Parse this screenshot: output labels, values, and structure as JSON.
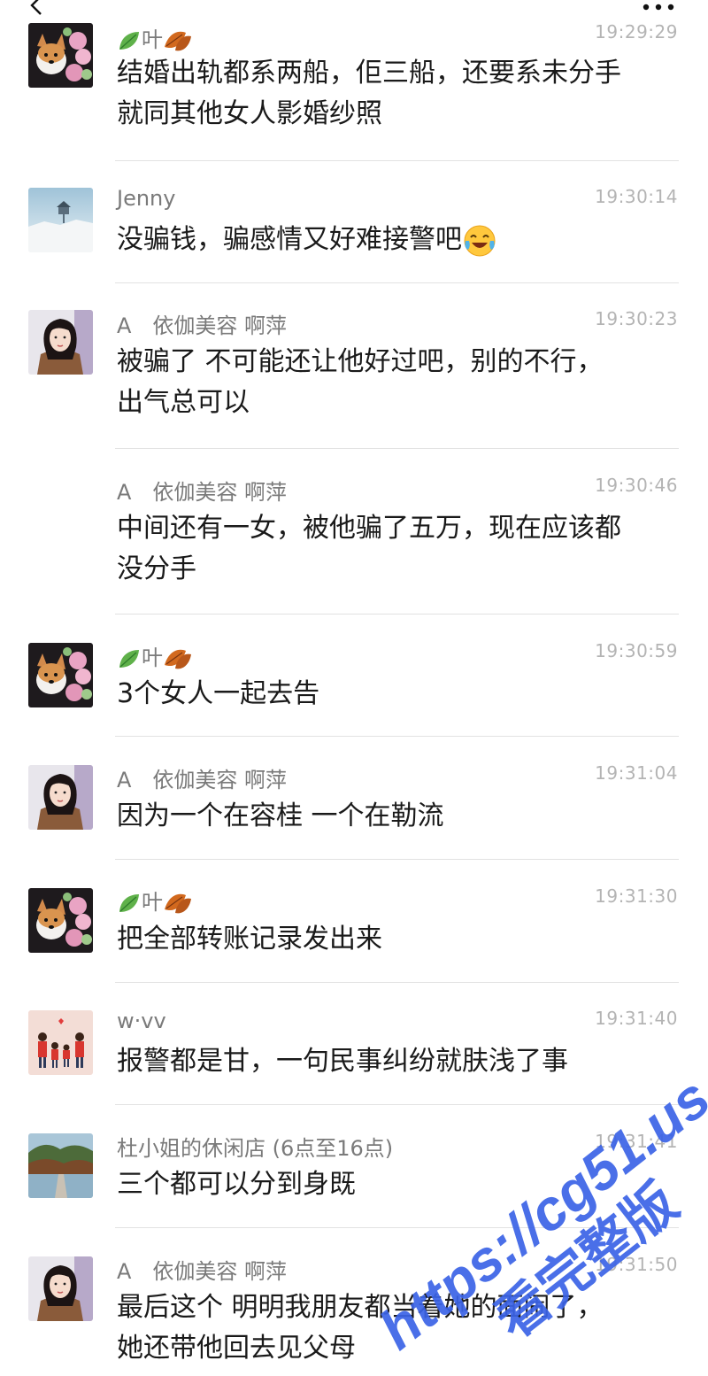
{
  "nav": {
    "back_icon": "chevron-left-icon",
    "more_icon": "more-dots-icon"
  },
  "messages": [
    {
      "name": "叶",
      "name_style": "leaf",
      "time": "19:29:29",
      "line1": "结婚出轨都系两船，佢三船，还要系未分手",
      "line2": "就同其他女人影婚纱照",
      "avatar": "corgi",
      "show_avatar": true
    },
    {
      "name": "Jenny",
      "time": "19:30:14",
      "line1": "没骗钱，骗感情又好难接警吧",
      "line2": "",
      "avatar": "snow",
      "show_avatar": true,
      "emoji": "crying-laughing-emoji"
    },
    {
      "name": "A　依伽美容 啊萍",
      "time": "19:30:23",
      "line1": "被骗了 不可能还让他好过吧，别的不行，",
      "line2": "出气总可以",
      "avatar": "girl",
      "show_avatar": true
    },
    {
      "name": "A　依伽美容 啊萍",
      "time": "19:30:46",
      "line1": "中间还有一女，被他骗了五万，现在应该都",
      "line2": "没分手",
      "avatar": "girl",
      "show_avatar": false
    },
    {
      "name": "叶",
      "name_style": "leaf",
      "time": "19:30:59",
      "line1": "3个女人一起去告",
      "line2": "",
      "avatar": "corgi",
      "show_avatar": true
    },
    {
      "name": "A　依伽美容 啊萍",
      "time": "19:31:04",
      "line1": "因为一个在容桂 一个在勒流",
      "line2": "",
      "avatar": "girl",
      "show_avatar": true
    },
    {
      "name": "叶",
      "name_style": "leaf",
      "time": "19:31:30",
      "line1": "把全部转账记录发出来",
      "line2": "",
      "avatar": "corgi",
      "show_avatar": true
    },
    {
      "name": "w·vv",
      "time": "19:31:40",
      "line1": "报警都是甘，一句民事纠纷就肤浅了事",
      "line2": "",
      "avatar": "family",
      "show_avatar": true
    },
    {
      "name": "杜小姐的休闲店 (6点至16点)",
      "time": "19:31:41",
      "line1": "三个都可以分到身既",
      "line2": "",
      "avatar": "lake",
      "show_avatar": true
    },
    {
      "name": "A　依伽美容 啊萍",
      "time": "19:31:50",
      "line1": "最后这个 明明我朋友都当着她的面闹了，",
      "line2": "她还带他回去见父母",
      "avatar": "girl",
      "show_avatar": true
    }
  ],
  "watermark": {
    "line1": "https://cg51.us",
    "line2": "看完整版",
    "color": "#3b63e6"
  }
}
